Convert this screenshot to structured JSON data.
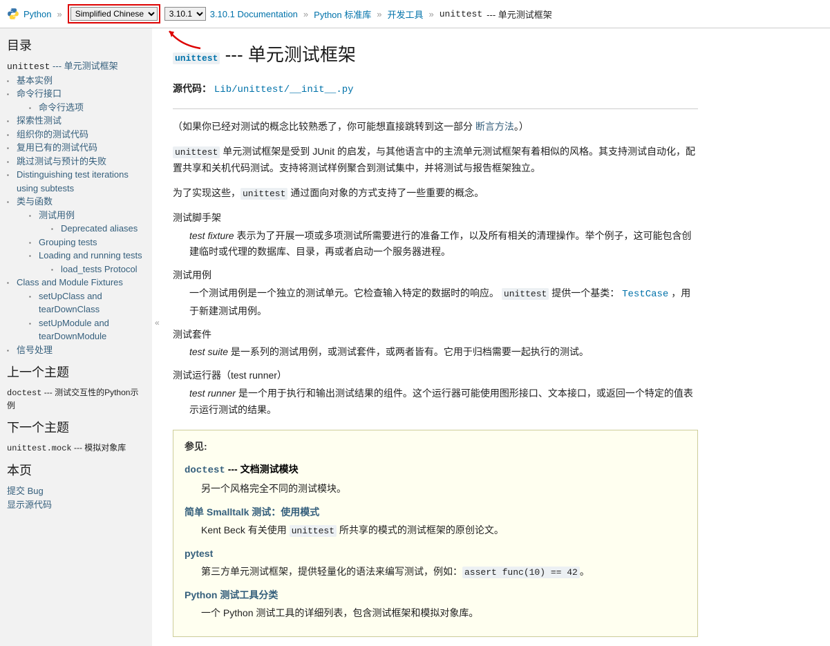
{
  "topbar": {
    "python": "Python",
    "sep": "»",
    "language": "Simplified Chinese",
    "version": "3.10.1",
    "breadcrumbs": [
      "3.10.1 Documentation",
      "Python 标准库",
      "开发工具"
    ],
    "current_code": "unittest",
    "current_suffix": " --- 单元测试框架"
  },
  "sidebar": {
    "toc_title": "目录",
    "root": {
      "code": "unittest",
      "suffix": " --- 单元测试框架"
    },
    "items": [
      {
        "label": "基本实例"
      },
      {
        "label": "命令行接口",
        "children": [
          {
            "label": "命令行选项"
          }
        ]
      },
      {
        "label": "探索性测试"
      },
      {
        "label": "组织你的测试代码"
      },
      {
        "label": "复用已有的测试代码"
      },
      {
        "label": "跳过测试与预计的失败"
      },
      {
        "label": "Distinguishing test iterations using subtests"
      },
      {
        "label": "类与函数",
        "children": [
          {
            "label": "测试用例",
            "children": [
              {
                "label": "Deprecated aliases"
              }
            ]
          },
          {
            "label": "Grouping tests"
          },
          {
            "label": "Loading and running tests",
            "children": [
              {
                "label": "load_tests Protocol"
              }
            ]
          }
        ]
      },
      {
        "label": "Class and Module Fixtures",
        "children": [
          {
            "label": "setUpClass and tearDownClass"
          },
          {
            "label": "setUpModule and tearDownModule"
          }
        ]
      },
      {
        "label": "信号处理"
      }
    ],
    "prev_title": "上一个主题",
    "prev": {
      "code": "doctest",
      "suffix": " --- 测试交互性的Python示例"
    },
    "next_title": "下一个主题",
    "next": {
      "code": "unittest.mock",
      "suffix": " --- 模拟对象库"
    },
    "this_page_title": "本页",
    "this_page_items": [
      "提交 Bug",
      "显示源代码"
    ]
  },
  "content": {
    "h1_code": "unittest",
    "h1_suffix": " --- 单元测试框架",
    "source_label": "源代码：",
    "source_link": "Lib/unittest/__init__.py",
    "intro_pre": "（如果你已经对测试的概念比较熟悉了，你可能想直接跳转到这一部分 ",
    "intro_link": "断言方法",
    "intro_post": "。）",
    "p2_code": "unittest",
    "p2_text": " 单元测试框架是受到 JUnit 的启发，与其他语言中的主流单元测试框架有着相似的风格。其支持测试自动化，配置共享和关机代码测试。支持将测试样例聚合到测试集中，并将测试与报告框架独立。",
    "p3_pre": "为了实现这些，",
    "p3_code": "unittest",
    "p3_post": " 通过面向对象的方式支持了一些重要的概念。",
    "defs": [
      {
        "term": "测试脚手架",
        "body_italic": "test fixture",
        "body": " 表示为了开展一项或多项测试所需要进行的准备工作，以及所有相关的清理操作。举个例子，这可能包含创建临时或代理的数据库、目录，再或者启动一个服务器进程。"
      },
      {
        "term": "测试用例",
        "body": "一个测试用例是一个独立的测试单元。它检查输入特定的数据时的响应。 ",
        "code1": "unittest",
        "mid": " 提供一个基类： ",
        "code2": "TestCase",
        "tail": " ，用于新建测试用例。"
      },
      {
        "term": "测试套件",
        "body_italic": "test suite",
        "body": " 是一系列的测试用例，或测试套件，或两者皆有。它用于归档需要一起执行的测试。"
      },
      {
        "term": "测试运行器（test runner）",
        "body_italic": "test runner",
        "body": " 是一个用于执行和输出测试结果的组件。这个运行器可能使用图形接口、文本接口，或返回一个特定的值表示运行测试的结果。"
      }
    ],
    "see_also": {
      "label": "参见:",
      "items": [
        {
          "link_code": "doctest",
          "title_bold": " --- 文档测试模块",
          "body": "另一个风格完全不同的测试模块。"
        },
        {
          "title_link": "简单 Smalltalk 测试：使用模式",
          "body_pre": "Kent Beck 有关使用 ",
          "body_code": "unittest",
          "body_post": " 所共享的模式的测试框架的原创论文。"
        },
        {
          "title_link": "pytest",
          "body_pre": "第三方单元测试框架，提供轻量化的语法来编写测试，例如：",
          "body_code": "assert func(10) == 42",
          "body_post": "。"
        },
        {
          "title_link": "Python 测试工具分类",
          "body": "一个 Python 测试工具的详细列表，包含测试框架和模拟对象库。"
        }
      ]
    }
  }
}
